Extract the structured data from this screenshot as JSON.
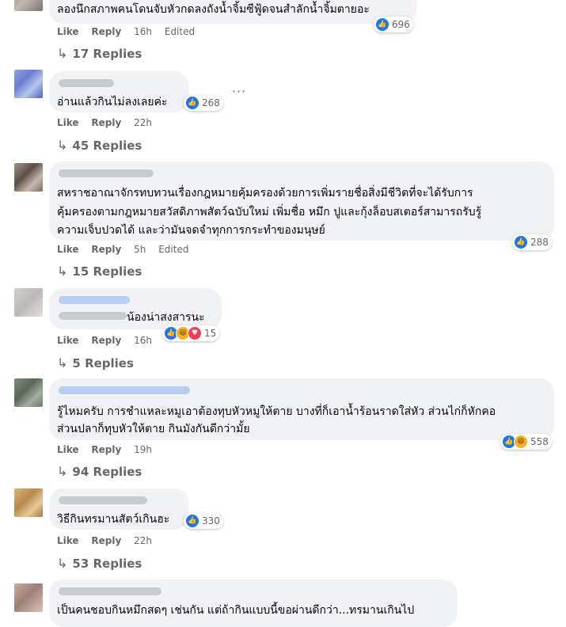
{
  "comments": [
    {
      "text": [
        "ลองนึกสภาพคนโดนจับหัวกดลงถังน้ำจิ้มซีฟู้ดจนสำลักน้ำจิ้มตายอะ"
      ],
      "like": "Like",
      "reply": "Reply",
      "time": "16h",
      "edited": "Edited",
      "reaction_count": "696",
      "reaction_icons": [
        "like-icon"
      ],
      "replies": "17 Replies"
    },
    {
      "text": [
        "อ่านแล้วกินไม่ลงเลยค่ะ"
      ],
      "like": "Like",
      "reply": "Reply",
      "time": "22h",
      "reaction_count": "268",
      "reaction_icons": [
        "like-icon"
      ],
      "more": "···",
      "replies": "45 Replies"
    },
    {
      "text": [
        "สหราชอาณาจักรทบทวนเรื่องกฎหมายคุ้มครองด้วยการเพิ่มรายชื่อสิ่งมีชีวิตที่จะได้รับการ",
        "คุ้มครองตามกฎหมายสวัสดิภาพสัตว์ฉบับใหม่ เพิ่มชื่อ หมึก ปูและกุ้งล็อบสเตอร์สามารถรับรู้",
        "ความเจ็บปวดได้ และว่ามันจดจำทุกการกระทำของมนุษย์"
      ],
      "like": "Like",
      "reply": "Reply",
      "time": "5h",
      "edited": "Edited",
      "reaction_count": "288",
      "reaction_icons": [
        "like-icon"
      ],
      "replies": "15 Replies"
    },
    {
      "text": [
        "น้องน่าสงสารนะ"
      ],
      "like": "Like",
      "reply": "Reply",
      "time": "16h",
      "reaction_count": "15",
      "reaction_icons": [
        "like-icon",
        "haha-icon",
        "love-icon"
      ],
      "replies": "5 Replies"
    },
    {
      "text": [
        "รู้ไหมครับ การชำแหละหมูเอาต้องทุบหัวหมูให้ตาย บางที่ก็เอาน้ำร้อนราดใส่หัว ส่วนไก่ก็หักคอ",
        "ส่วนปลาก็ทุบหัวให้ตาย กินมังกันดีกว่ามั้ย"
      ],
      "like": "Like",
      "reply": "Reply",
      "time": "19h",
      "reaction_count": "558",
      "reaction_icons": [
        "like-icon",
        "haha-icon"
      ],
      "replies": "94 Replies"
    },
    {
      "text": [
        "วิธีกินทรมานสัตว์เกินฮะ"
      ],
      "like": "Like",
      "reply": "Reply",
      "time": "22h",
      "reaction_count": "330",
      "reaction_icons": [
        "like-icon"
      ],
      "replies": "53 Replies"
    },
    {
      "text": [
        "เป็นคนชอบกินหมึกสดๆ เช่นกัน แต่ถ้ากินแบบนี้ขอผ่านดีกว่า...ทรมานเกินไป"
      ]
    }
  ]
}
